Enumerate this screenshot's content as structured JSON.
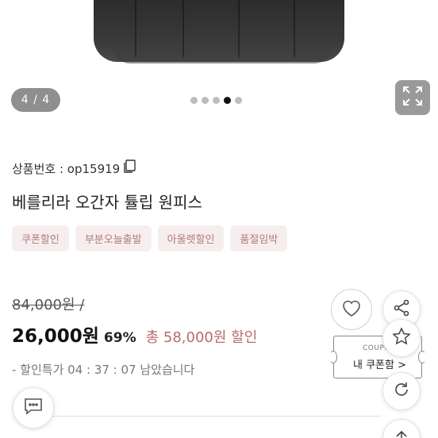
{
  "gallery": {
    "counter": "4 / 4",
    "dots": 5,
    "active_dot": 4
  },
  "product": {
    "number_label": "상품번호 : op15919",
    "title": "베를리라 오간자 튤립 원피스",
    "tags": [
      "쿠폰할인",
      "부분오늘출발",
      "아울렛할인",
      "품절임박"
    ]
  },
  "price": {
    "original": "84,000원 /",
    "sale": "26,000원",
    "rate": "69%",
    "discount": "총 58,000원 할인"
  },
  "timer": "- 할인특가 04 : 37 : 07 남았습니다",
  "coupon": {
    "small": "COUPON",
    "label": "내 쿠폰함 >"
  },
  "colors": {
    "tag_bg": "#f6eeee",
    "tag_text": "#b5787a",
    "discount": "#b96a6d"
  }
}
